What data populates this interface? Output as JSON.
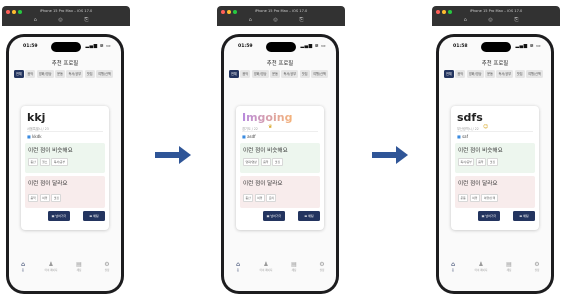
{
  "simulator": {
    "title": "iPhone 15 Pro Max – iOS 17.0",
    "light_colors": [
      "#ff5f57",
      "#febc2e",
      "#28c840"
    ],
    "tool_icons": "⌂ ◎ ⎘"
  },
  "app": {
    "title": "추천 프로필",
    "categories": [
      "전체",
      "음악",
      "영화/영상",
      "운동",
      "독서/공부",
      "맛집",
      "여행/산책"
    ],
    "same_title": "이런 점이 비슷해요",
    "diff_title": "이런 점이 달라요",
    "skip_label": "넘어가기",
    "chat_label": "채팅",
    "skip_icon": "skip-icon",
    "chat_icon": "chat-icon",
    "status_icons": "▂▄▆ ≋ ▭",
    "tabs": [
      {
        "icon": "⌂",
        "label": "홈"
      },
      {
        "icon": "♟",
        "label": "마이 페이지"
      },
      {
        "icon": "▤",
        "label": "채팅"
      },
      {
        "icon": "⚙",
        "label": "설정"
      }
    ]
  },
  "screens": [
    {
      "time": "01:59",
      "name": "kkj",
      "name_style": "plain",
      "sub": "서울특별시 / 23",
      "emoji": "",
      "tag": "kkdk",
      "same_items": [
        "등산",
        "헬스",
        "독서/공부"
      ],
      "diff_items": [
        "음악",
        "여행",
        "맛집"
      ]
    },
    {
      "time": "01:59",
      "name": "Imgoing",
      "name_style": "gradient",
      "sub": "경기도 / 22",
      "emoji": "♛",
      "tag": "asdf",
      "same_items": [
        "영화/영상",
        "음악",
        "맛집"
      ],
      "diff_items": [
        "등산",
        "여행",
        "요리"
      ]
    },
    {
      "time": "01:58",
      "name": "sdfs",
      "name_style": "plain",
      "sub": "부산광역시 / 22",
      "emoji": "☺",
      "tag": "saf",
      "same_items": [
        "독서/공부",
        "음악",
        "맛집"
      ],
      "diff_items": [
        "운동",
        "여행",
        "여행/산책"
      ]
    }
  ],
  "arrow_color": "#2f5597",
  "accent_color": "#23345f"
}
